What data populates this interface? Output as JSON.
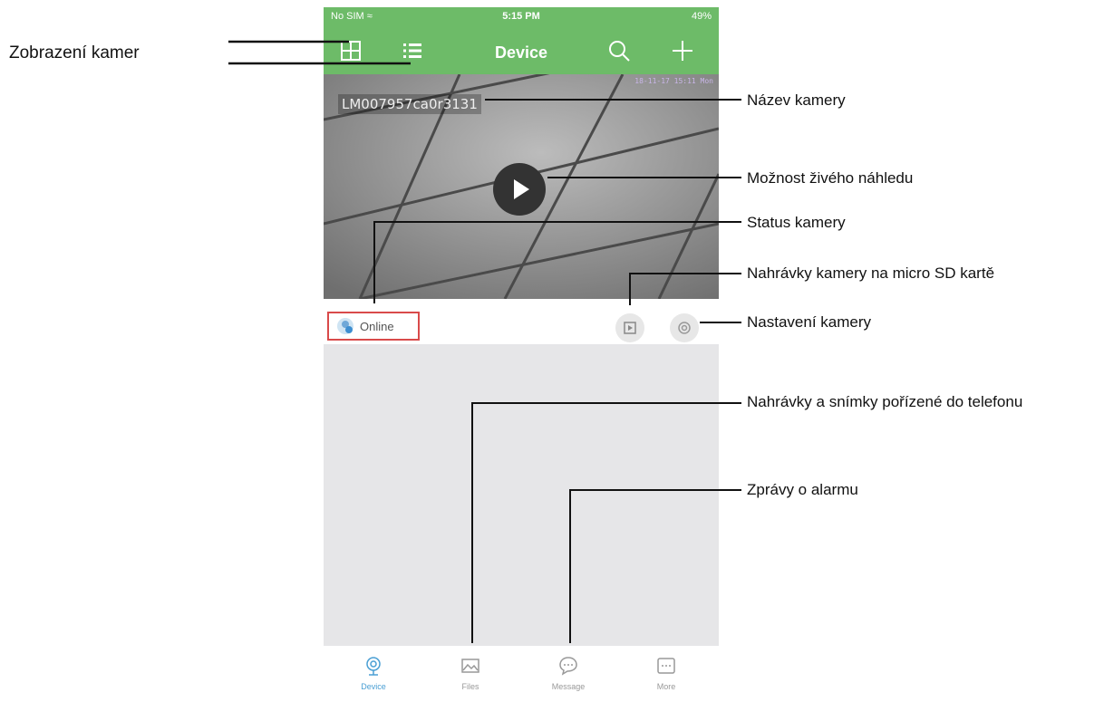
{
  "status_bar": {
    "carrier": "No SIM ≈",
    "time": "5:15 PM",
    "battery": "49%"
  },
  "nav": {
    "title": "Device",
    "icons": [
      "grid-view-icon",
      "list-view-icon",
      "search-icon",
      "add-icon"
    ]
  },
  "camera": {
    "name": "LM007957ca0r3131",
    "timestamp": "18-11-17 15:11 Mon",
    "status": "Online"
  },
  "tabs": [
    {
      "label": "Device",
      "icon": "camera-icon"
    },
    {
      "label": "Files",
      "icon": "image-icon"
    },
    {
      "label": "Message",
      "icon": "chat-icon"
    },
    {
      "label": "More",
      "icon": "more-icon"
    }
  ],
  "annotations": {
    "camera_view": "Zobrazení kamer",
    "camera_name": "Název kamery",
    "live_preview": "Možnost živého náhledu",
    "camera_status": "Status kamery",
    "sd_recordings": "Nahrávky kamery na micro SD kartě",
    "camera_settings": "Nastavení kamery",
    "phone_recordings": "Nahrávky a snímky pořízené do telefonu",
    "alarm_messages": "Zprávy o alarmu"
  },
  "colors": {
    "header_green": "#6dbb68",
    "status_border": "#d94a4a",
    "active_tab": "#4a9fd4"
  }
}
